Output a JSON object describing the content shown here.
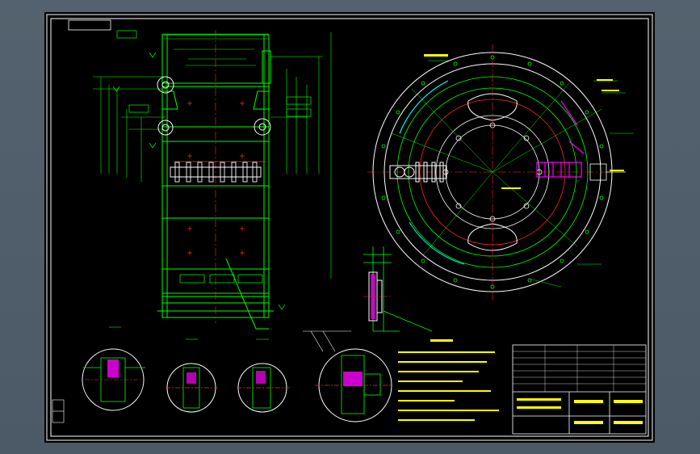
{
  "colors": {
    "viewport_bg": "#52606e",
    "sheet_bg": "#000000",
    "frame": "#ffffff",
    "outline": "#00ff00",
    "center_line": "#ff2a2a",
    "dimension": "#ffff00",
    "highlight": "#ff00ff",
    "accent": "#00ffff"
  },
  "views": [
    {
      "name": "front-section-view"
    },
    {
      "name": "circular-plan-view"
    },
    {
      "name": "side-profile-view"
    }
  ],
  "detail_views": [
    {
      "name": "detail-view-i"
    },
    {
      "name": "detail-view-ii"
    },
    {
      "name": "detail-view-iii"
    },
    {
      "name": "detail-view-iv"
    }
  ],
  "notes": {
    "count": 8,
    "heading_legible": false
  },
  "title_block": {
    "legible": false
  }
}
